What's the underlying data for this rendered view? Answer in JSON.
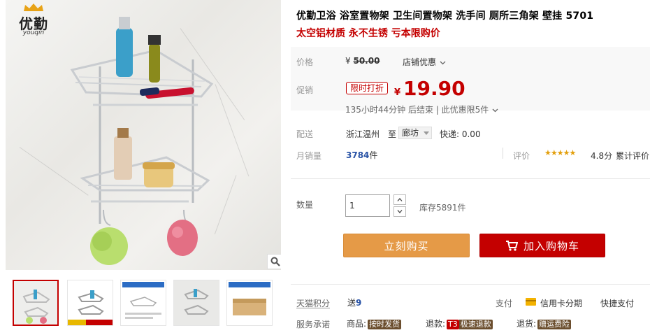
{
  "brand": {
    "name_cn": "优勤",
    "name_en": "youqin"
  },
  "product": {
    "title": "优勤卫浴 浴室置物架 卫生间置物架 洗手间 厕所三角架 壁挂 5701",
    "subtitle": "太空铝材质 永不生锈 亏本限购价"
  },
  "price": {
    "label": "价格",
    "currency": "¥",
    "original": "50.00",
    "store_discount": "店铺优惠"
  },
  "promo": {
    "label": "促销",
    "badge": "限时打折",
    "currency": "¥",
    "price": "19.90",
    "timer": "135小时44分钟 后结束 | 此优惠限5件"
  },
  "shipping": {
    "label": "配送",
    "origin": "浙江温州",
    "to": "至",
    "destination": "廊坊",
    "express": "快递: 0.00"
  },
  "sales": {
    "label": "月销量",
    "count": "3784",
    "unit": "件",
    "rating_label": "评价",
    "stars": "★★★★★",
    "score": "4.8分",
    "total_reviews": "累计评价"
  },
  "quantity": {
    "label": "数量",
    "value": "1",
    "stock": "库存5891件"
  },
  "actions": {
    "buy_now": "立刻购买",
    "add_to_cart": "加入购物车"
  },
  "points": {
    "label": "天猫积分",
    "prefix": "送",
    "value": "9"
  },
  "payment": {
    "label": "支付",
    "credit": "信用卡分期",
    "quick": "快捷支付"
  },
  "service": {
    "label": "服务承诺",
    "item1": "商品:",
    "tag1": "按时发货",
    "item2": "退款:",
    "tag2_prefix": "T3",
    "tag2": "极速退款",
    "item3": "退货:",
    "tag3": "赠运费险"
  },
  "colors": {
    "accent_red": "#c40000",
    "buy_orange": "#e59a47",
    "link_blue": "#2953a6",
    "star_gold": "#e3a00e"
  }
}
